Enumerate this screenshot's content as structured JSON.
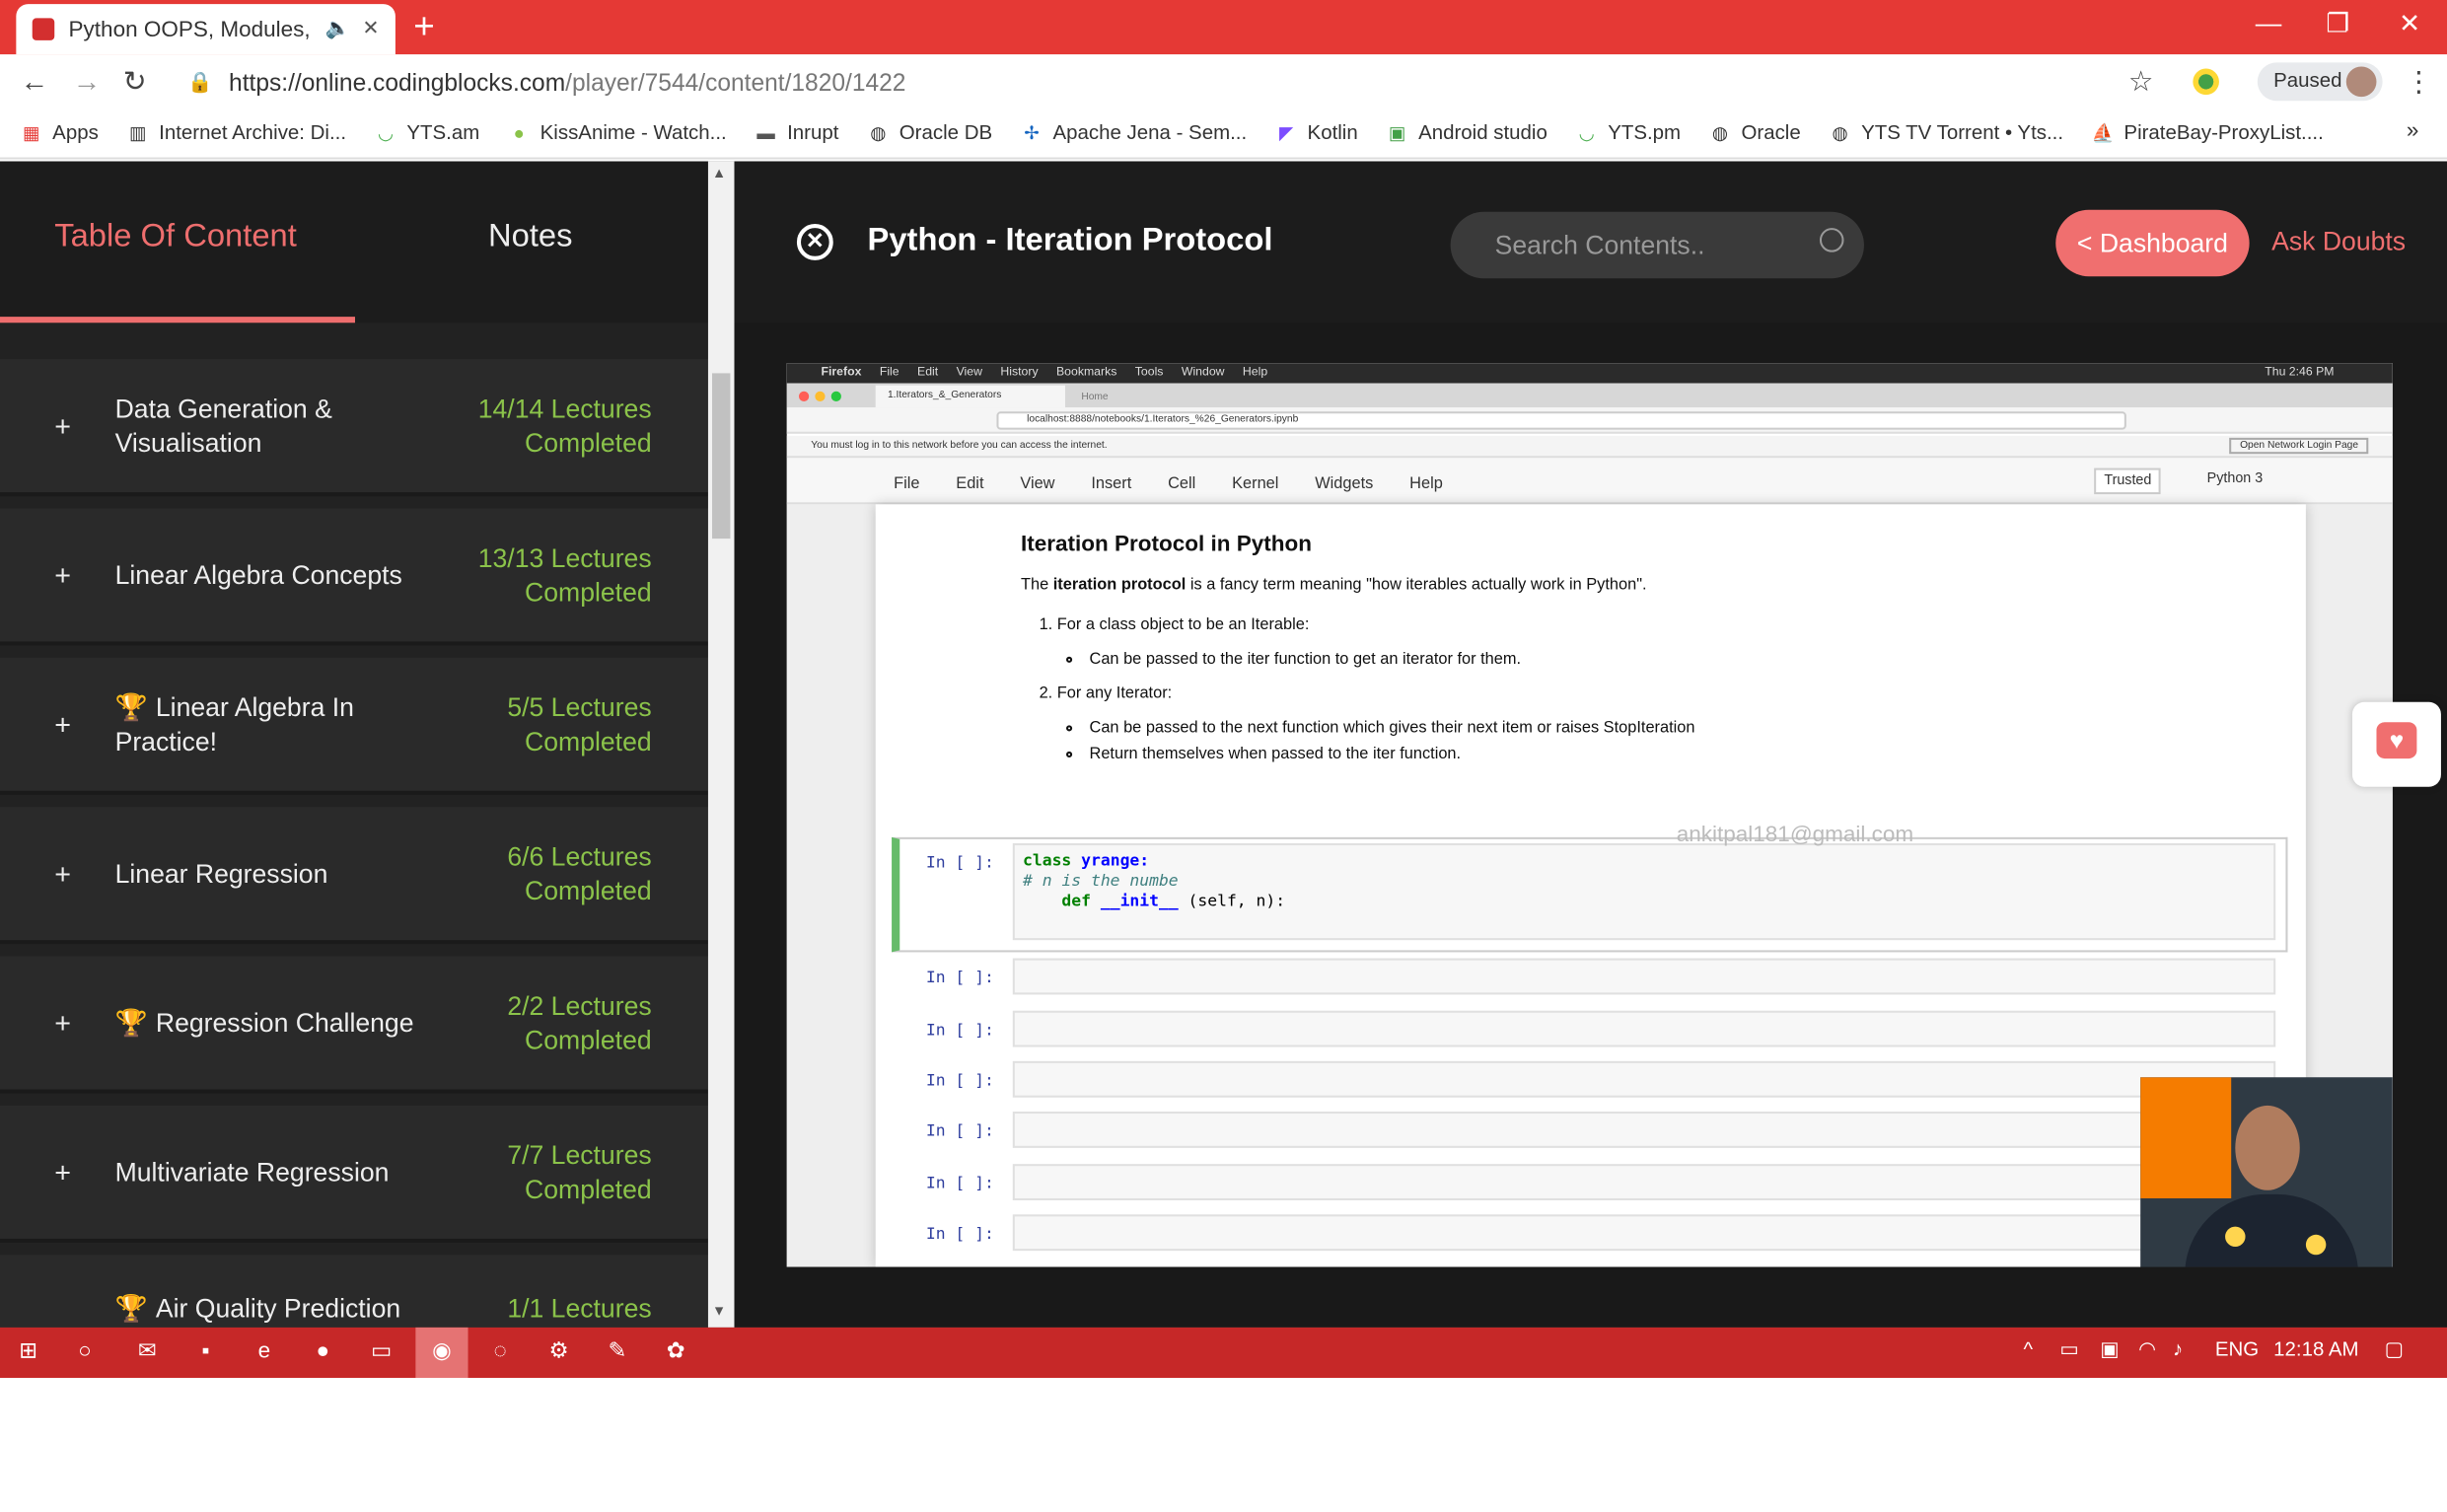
{
  "browser": {
    "tab_title": "Python OOPS, Modules, File",
    "url_host": "https://online.codingblocks.com",
    "url_path": "/player/7544/content/1820/1422",
    "profile_status": "Paused",
    "bookmarks": [
      "Apps",
      "Internet Archive: Di...",
      "YTS.am",
      "KissAnime - Watch...",
      "Inrupt",
      "Oracle DB",
      "Apache Jena - Sem...",
      "Kotlin",
      "Android studio",
      "YTS.pm",
      "Oracle",
      "YTS TV Torrent • Yts...",
      "PirateBay-ProxyList...."
    ],
    "more": "»"
  },
  "sidebar": {
    "tab_toc": "Table Of Content",
    "tab_notes": "Notes",
    "sections": [
      {
        "title": "Data Generation & Visualisation",
        "trophy": false,
        "count": "14/14 Lectures Completed"
      },
      {
        "title": "Linear Algebra Concepts",
        "trophy": false,
        "count": "13/13 Lectures Completed"
      },
      {
        "title": "Linear Algebra In Practice!",
        "trophy": true,
        "count": "5/5 Lectures Completed"
      },
      {
        "title": "Linear Regression",
        "trophy": false,
        "count": "6/6 Lectures Completed"
      },
      {
        "title": "Regression Challenge",
        "trophy": true,
        "count": "2/2 Lectures Completed"
      },
      {
        "title": "Multivariate Regression",
        "trophy": false,
        "count": "7/7 Lectures Completed"
      },
      {
        "title": "Air Quality Prediction",
        "trophy": true,
        "count": "1/1 Lectures"
      }
    ]
  },
  "header": {
    "lesson_title": "Python - Iteration Protocol",
    "search_placeholder": "Search Contents..",
    "dashboard_label": "< Dashboard",
    "ask_label": "Ask Doubts"
  },
  "video": {
    "mac_menu": [
      "Firefox",
      "File",
      "Edit",
      "View",
      "History",
      "Bookmarks",
      "Tools",
      "Window",
      "Help"
    ],
    "mac_time": "Thu 2:46 PM",
    "ff_tab_active": "1.Iterators_&_Generators",
    "ff_tab_other": "Home",
    "ff_url": "localhost:8888/notebooks/1.Iterators_%26_Generators.ipynb",
    "warning": "You must log in to this network before you can access the internet.",
    "warning_btn": "Open Network Login Page",
    "jupyter_menu": [
      "File",
      "Edit",
      "View",
      "Insert",
      "Cell",
      "Kernel",
      "Widgets",
      "Help"
    ],
    "trusted": "Trusted",
    "kernel": "Python 3",
    "md_title": "Iteration Protocol in Python",
    "md_intro_pre": "The ",
    "md_intro_bold": "iteration protocol",
    "md_intro_post": " is a fancy term meaning \"how iterables actually work in Python\".",
    "md_item1": "For a class object to be an Iterable:",
    "md_item1_sub": "Can be passed to the iter function to get an iterator for them.",
    "md_item2": "For any Iterator:",
    "md_item2_sub1": "Can be passed to the next function which gives their next item or raises StopIteration",
    "md_item2_sub2": "Return themselves when passed to the iter function.",
    "prompt": "In [ ]:",
    "code_kw_class": "class",
    "code_name": "yrange:",
    "code_comment": "#     n is the numbe",
    "code_kw_def": "def",
    "code_init": "__init__",
    "code_args": "(self, n):",
    "watermark": "ankitpal181@gmail.com"
  },
  "taskbar": {
    "lang": "ENG",
    "time": "12:18 AM"
  },
  "colors": {
    "chrome_red": "#e53935",
    "accent": "#f06f6f",
    "completed_green": "#8bc34a"
  }
}
